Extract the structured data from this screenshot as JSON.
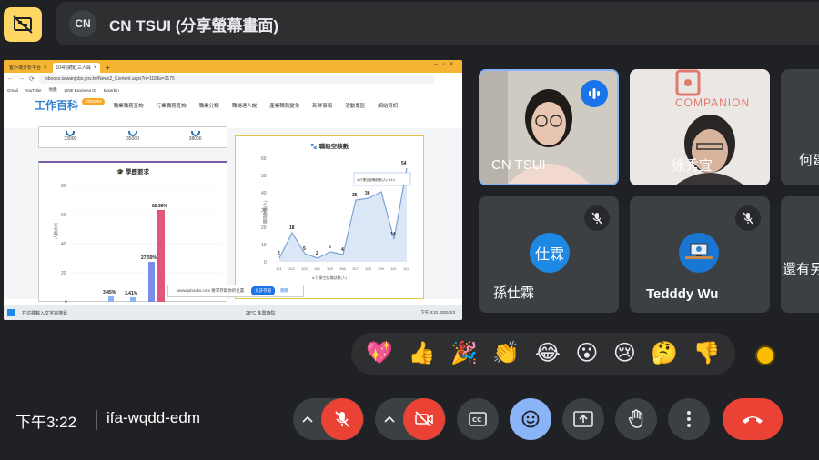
{
  "presentation": {
    "presenter_initials": "CN",
    "title": "CN TSUI (分享螢幕畫面)"
  },
  "shared_screen": {
    "tabs": [
      {
        "label": "客戶端分析平台"
      },
      {
        "label": "104招聘紅三人員"
      }
    ],
    "url": "jobooks.taiwanjobs.gov.tw/News2_Content.aspx?n=118&s=2175",
    "bookmarks": [
      "Gmail",
      "YouTube",
      "地圖",
      "LINE Business ID",
      "Mixerbin"
    ],
    "site": {
      "logo": "工作百科",
      "badge": "Jobooks",
      "nav": [
        "職業職務查詢",
        "行業職務查詢",
        "職業分類",
        "職場達人說",
        "產業職務變化",
        "新鮮事報",
        "活動專區",
        "網站資訊"
      ]
    },
    "top_values": [
      "33000",
      "35000",
      "38000"
    ],
    "edu_chart": {
      "title": "學歷要求",
      "ylabel": "人數比例",
      "yticks": [
        "80",
        "60",
        "40",
        "20",
        "0"
      ],
      "bar_labels": [
        "3.45%",
        "3.41%",
        "27.59%",
        "62.96%"
      ]
    },
    "vacancy_chart": {
      "title": "職缺空缺數",
      "ylabel": "職缺數量(人)",
      "yticks": [
        "60",
        "50",
        "40",
        "30",
        "20",
        "10",
        "0"
      ],
      "xticks": [
        "101",
        "102",
        "103",
        "104",
        "105",
        "106",
        "107",
        "108",
        "109",
        "110",
        "111"
      ],
      "point_labels": [
        "2",
        "18",
        "5",
        "2",
        "6",
        "4",
        "35",
        "36",
        "",
        "14",
        "54"
      ],
      "tooltip": "● 行業空缺職缺數(人): 54人",
      "legend": "● 行業空缺職缺數(人)"
    },
    "popup_text": "www.jobooks.com 要求存取你的位置",
    "popup_button": "允許存取",
    "popup_close": "關閉",
    "taskbar": {
      "search": "在這裡輸入文字來搜尋",
      "weather": "28°C 多雲時陰",
      "time": "下午 3:22 2022/8/3"
    }
  },
  "participants": [
    {
      "name": "CN TSUI",
      "speaking": true
    },
    {
      "name": "徐秀宜",
      "brand": "COMPANION"
    },
    {
      "name": "何建"
    },
    {
      "name": "孫仕霖",
      "avatar_text": "仕霖",
      "muted": true,
      "avatar_color": "#1e88e5"
    },
    {
      "name": "Tedddy Wu",
      "muted": true
    },
    {
      "name": "還有另"
    }
  ],
  "reactions": [
    "💖",
    "👍",
    "🎉",
    "👏",
    "😂",
    "😮",
    "😢",
    "🤔",
    "👎"
  ],
  "bottom_bar": {
    "time": "下午3:22",
    "meeting_code": "ifa-wqdd-edm"
  },
  "colors": {
    "accent_yellow": "#fdd663",
    "danger_red": "#ea4335",
    "active_blue": "#8ab4f8",
    "speaking_blue": "#1a73e8"
  }
}
